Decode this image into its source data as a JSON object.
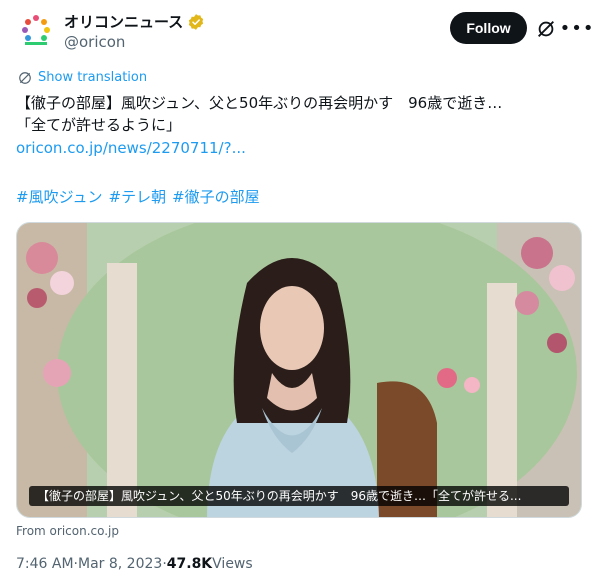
{
  "author": {
    "display_name": "オリコンニュース",
    "handle": "@oricon"
  },
  "actions": {
    "follow_label": "Follow"
  },
  "tweet": {
    "show_translation": "Show translation",
    "line1": "【徹子の部屋】風吹ジュン、父と50年ぶりの再会明かす　96歳で逝き…",
    "line2": "「全てが許せるように」",
    "link": "oricon.co.jp/news/2270711/?...",
    "hashtags": [
      "#風吹ジュン",
      "#テレ朝",
      "#徹子の部屋"
    ]
  },
  "media": {
    "caption": "【徹子の部屋】風吹ジュン、父と50年ぶりの再会明かす　96歳で逝き…「全てが許せる...",
    "source": "From oricon.co.jp"
  },
  "meta": {
    "time": "7:46 AM",
    "sep1": " · ",
    "date": "Mar 8, 2023",
    "sep2": " · ",
    "views_count": "47.8K",
    "views_label": " Views"
  },
  "colors": {
    "link_blue": "#1d9bf0",
    "verified_gold": "#e2b719",
    "text_primary": "#0f1419",
    "text_secondary": "#536471"
  },
  "icons": [
    "oricon-logo-icon",
    "verified-badge-icon",
    "grok-icon",
    "more-icon",
    "translate-globe-icon"
  ]
}
